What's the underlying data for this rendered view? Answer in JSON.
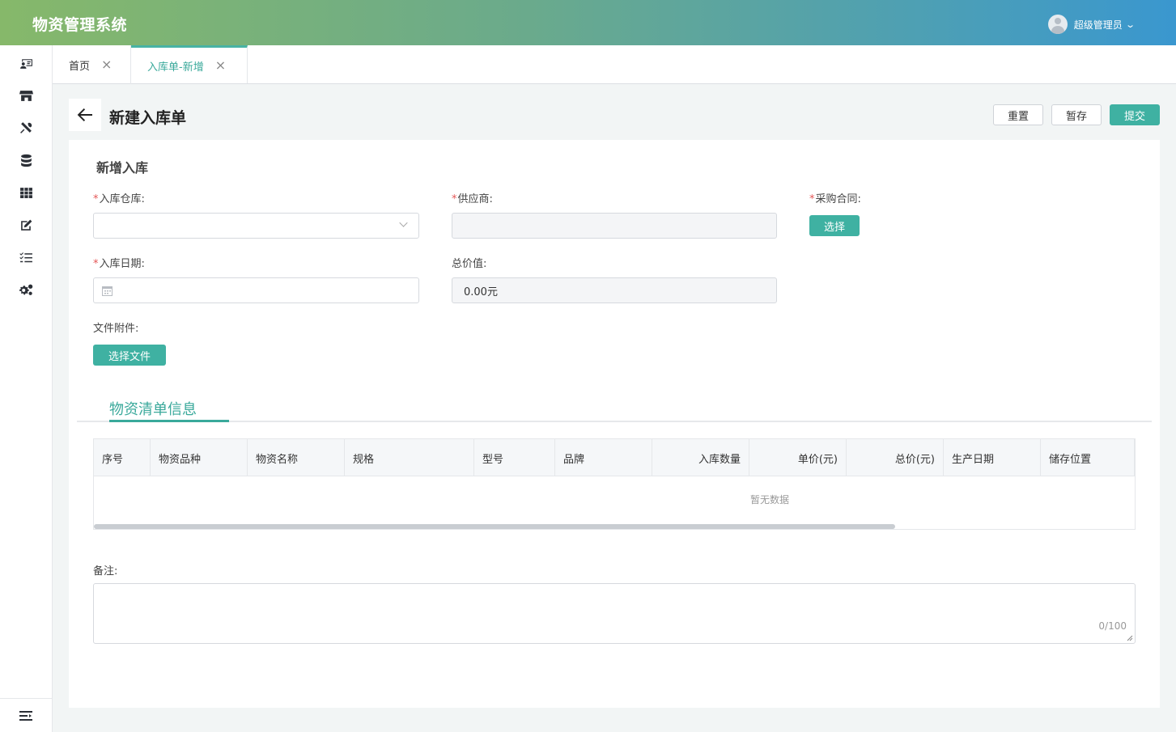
{
  "app": {
    "title": "物资管理系统"
  },
  "user": {
    "name": "超级管理员"
  },
  "sidebar": {
    "items": [
      {
        "icon": "user-card-icon"
      },
      {
        "icon": "store-icon"
      },
      {
        "icon": "tools-icon"
      },
      {
        "icon": "database-icon"
      },
      {
        "icon": "grid-icon"
      },
      {
        "icon": "edit-icon"
      },
      {
        "icon": "list-icon"
      },
      {
        "icon": "gears-icon"
      }
    ],
    "collapse_icon": "menu-fold-icon"
  },
  "tabs": [
    {
      "label": "首页",
      "active": false
    },
    {
      "label": "入库单-新增",
      "active": true
    }
  ],
  "page": {
    "title": "新建入库单",
    "buttons": {
      "reset": "重置",
      "draft": "暂存",
      "submit": "提交"
    }
  },
  "form": {
    "section_title": "新增入库",
    "warehouse": {
      "label": "入库仓库:",
      "value": ""
    },
    "supplier": {
      "label": "供应商:",
      "value": ""
    },
    "contract": {
      "label": "采购合同:",
      "button": "选择"
    },
    "date": {
      "label": "入库日期:",
      "value": ""
    },
    "total": {
      "label": "总价值:",
      "value": "0.00元"
    },
    "attachment": {
      "label": "文件附件:",
      "button": "选择文件"
    }
  },
  "detail_tab": {
    "label": "物资清单信息"
  },
  "table": {
    "columns": [
      "序号",
      "物资品种",
      "物资名称",
      "规格",
      "型号",
      "品牌",
      "入库数量",
      "单价(元)",
      "总价(元)",
      "生产日期",
      "储存位置"
    ],
    "empty_text": "暂无数据"
  },
  "remark": {
    "label": "备注:",
    "counter": "0/100"
  },
  "colors": {
    "accent": "#3fb1a2",
    "required": "#e45656"
  }
}
